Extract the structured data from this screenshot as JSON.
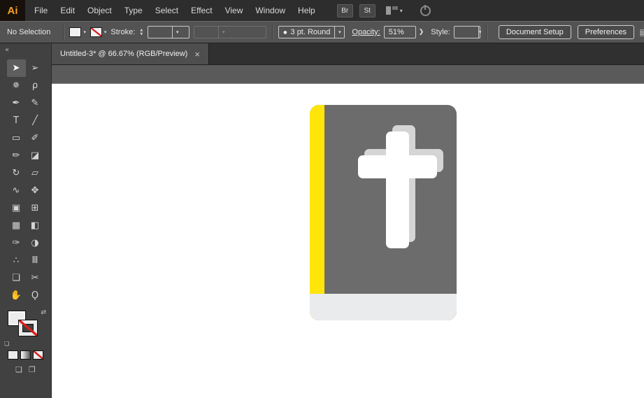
{
  "app": {
    "logo_text": "Ai"
  },
  "menu": {
    "items": [
      "File",
      "Edit",
      "Object",
      "Type",
      "Select",
      "Effect",
      "View",
      "Window",
      "Help"
    ]
  },
  "app_bar": {
    "bridge_button": "Br",
    "stock_button": "St"
  },
  "control_bar": {
    "selection_status": "No Selection",
    "stroke_label": "Stroke:",
    "brush_preset": "3 pt. Round",
    "opacity_label": "Opacity:",
    "opacity_value": "51%",
    "style_label": "Style:",
    "document_setup_button": "Document Setup",
    "preferences_button": "Preferences"
  },
  "document_tab": {
    "title": "Untitled-3* @ 66.67% (RGB/Preview)",
    "close_glyph": "×"
  },
  "tool_panel": {
    "collapse_glyph": "«",
    "swap_glyph": "⇄",
    "default_swatches_glyph": "❏",
    "tools": [
      {
        "name": "selection-tool",
        "glyph": "➤"
      },
      {
        "name": "direct-selection-tool",
        "glyph": "➢"
      },
      {
        "name": "magic-wand-tool",
        "glyph": "✵"
      },
      {
        "name": "lasso-tool",
        "glyph": "ρ"
      },
      {
        "name": "pen-tool",
        "glyph": "✒"
      },
      {
        "name": "shaper-tool",
        "glyph": "✎"
      },
      {
        "name": "type-tool",
        "glyph": "T"
      },
      {
        "name": "line-segment-tool",
        "glyph": "╱"
      },
      {
        "name": "rectangle-tool",
        "glyph": "▭"
      },
      {
        "name": "paintbrush-tool",
        "glyph": "✐"
      },
      {
        "name": "pencil-tool",
        "glyph": "✏"
      },
      {
        "name": "eraser-tool",
        "glyph": "◪"
      },
      {
        "name": "rotate-tool",
        "glyph": "↻"
      },
      {
        "name": "scale-tool",
        "glyph": "▱"
      },
      {
        "name": "width-tool",
        "glyph": "∿"
      },
      {
        "name": "free-transform-tool",
        "glyph": "✥"
      },
      {
        "name": "shape-builder-tool",
        "glyph": "▣"
      },
      {
        "name": "perspective-grid-tool",
        "glyph": "⊞"
      },
      {
        "name": "mesh-tool",
        "glyph": "▦"
      },
      {
        "name": "gradient-tool",
        "glyph": "◧"
      },
      {
        "name": "eyedropper-tool",
        "glyph": "✑"
      },
      {
        "name": "blend-tool",
        "glyph": "◑"
      },
      {
        "name": "symbol-sprayer-tool",
        "glyph": "∴"
      },
      {
        "name": "column-graph-tool",
        "glyph": "Ⅲ"
      },
      {
        "name": "artboard-tool",
        "glyph": "❏"
      },
      {
        "name": "slice-tool",
        "glyph": "✂"
      },
      {
        "name": "hand-tool",
        "glyph": "✋"
      },
      {
        "name": "zoom-tool",
        "glyph": "Ϙ"
      }
    ]
  },
  "glyphs": {
    "chevron_down": "▾",
    "stepper_up": "▲",
    "stepper_down": "▼",
    "flyout_arrow": "❯",
    "brush_dot": "●",
    "panel_edge": "▤",
    "draw_normal": "❏",
    "draw_behind": "❐"
  },
  "artwork": {
    "description": "flat bible book icon with white cross",
    "colors": {
      "spine_yellow": "#ffe50a",
      "cover_gray": "#6c6c6c",
      "cross_white": "#ffffff",
      "cross_shadow_gray": "#d5d5d5",
      "pages_gray": "#eaebec"
    }
  }
}
